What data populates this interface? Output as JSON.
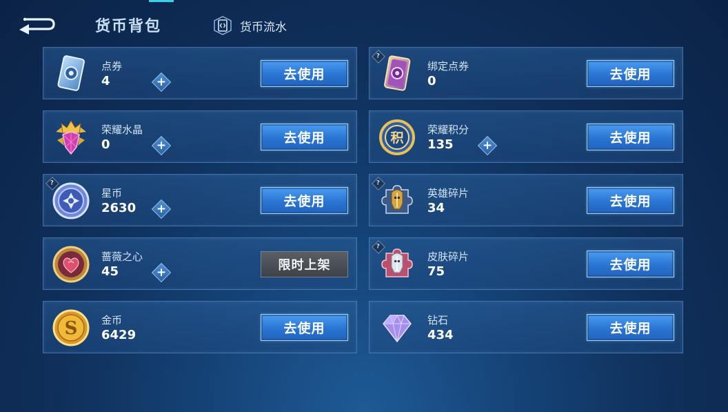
{
  "header": {
    "title": "货币背包",
    "ledger_label": "货币流水"
  },
  "currencies": [
    {
      "name": "点券",
      "amount": "4",
      "action": "去使用",
      "has_plus": true,
      "has_help": false,
      "icon": "voucher-card-icon"
    },
    {
      "name": "绑定点券",
      "amount": "0",
      "action": "去使用",
      "has_plus": false,
      "has_help": true,
      "icon": "bound-voucher-card-icon"
    },
    {
      "name": "荣耀水晶",
      "amount": "0",
      "action": "去使用",
      "has_plus": true,
      "has_help": false,
      "icon": "glory-crystal-icon"
    },
    {
      "name": "荣耀积分",
      "amount": "135",
      "action": "去使用",
      "has_plus": true,
      "has_help": false,
      "icon": "glory-points-coin-icon"
    },
    {
      "name": "星币",
      "amount": "2630",
      "action": "去使用",
      "has_plus": true,
      "has_help": true,
      "icon": "star-coin-icon"
    },
    {
      "name": "英雄碎片",
      "amount": "34",
      "action": "去使用",
      "has_plus": false,
      "has_help": true,
      "icon": "hero-fragment-icon"
    },
    {
      "name": "蔷薇之心",
      "amount": "45",
      "action": "限时上架",
      "has_plus": true,
      "has_help": false,
      "icon": "rose-heart-icon"
    },
    {
      "name": "皮肤碎片",
      "amount": "75",
      "action": "去使用",
      "has_plus": false,
      "has_help": true,
      "icon": "skin-fragment-icon"
    },
    {
      "name": "金币",
      "amount": "6429",
      "action": "去使用",
      "has_plus": false,
      "has_help": false,
      "icon": "gold-coin-icon"
    },
    {
      "name": "钻石",
      "amount": "434",
      "action": "去使用",
      "has_plus": false,
      "has_help": false,
      "icon": "diamond-icon"
    }
  ],
  "colors": {
    "background": "#0f2f5a",
    "button_blue": "#2a75d3",
    "button_disabled": "#4a4f56",
    "accent_cyan": "#38d3e8"
  }
}
